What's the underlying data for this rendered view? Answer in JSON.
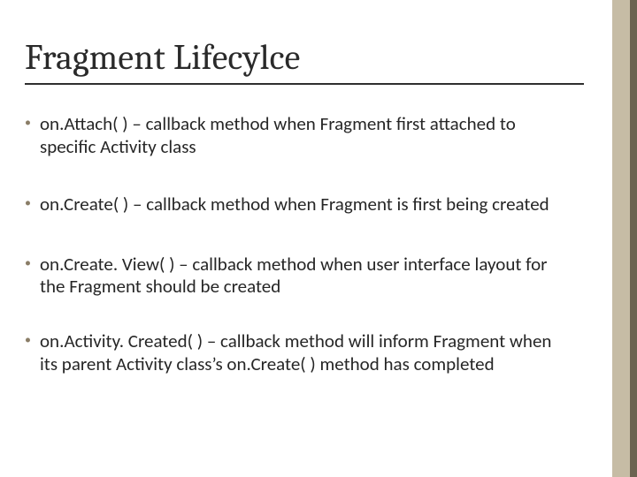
{
  "title": "Fragment Lifecylce",
  "accent_color": "#8a7d67",
  "band_colors": {
    "light": "#c6bca5",
    "dark": "#6b6350"
  },
  "bullets": [
    "on.Attach( ) – callback method when Fragment first attached to specific Activity class",
    "on.Create( ) – callback method when Fragment is first being created",
    "on.Create. View( ) – callback method when user interface layout for the Fragment should be created",
    "on.Activity. Created( ) – callback method will inform Fragment when its parent Activity class’s on.Create( ) method has completed"
  ]
}
